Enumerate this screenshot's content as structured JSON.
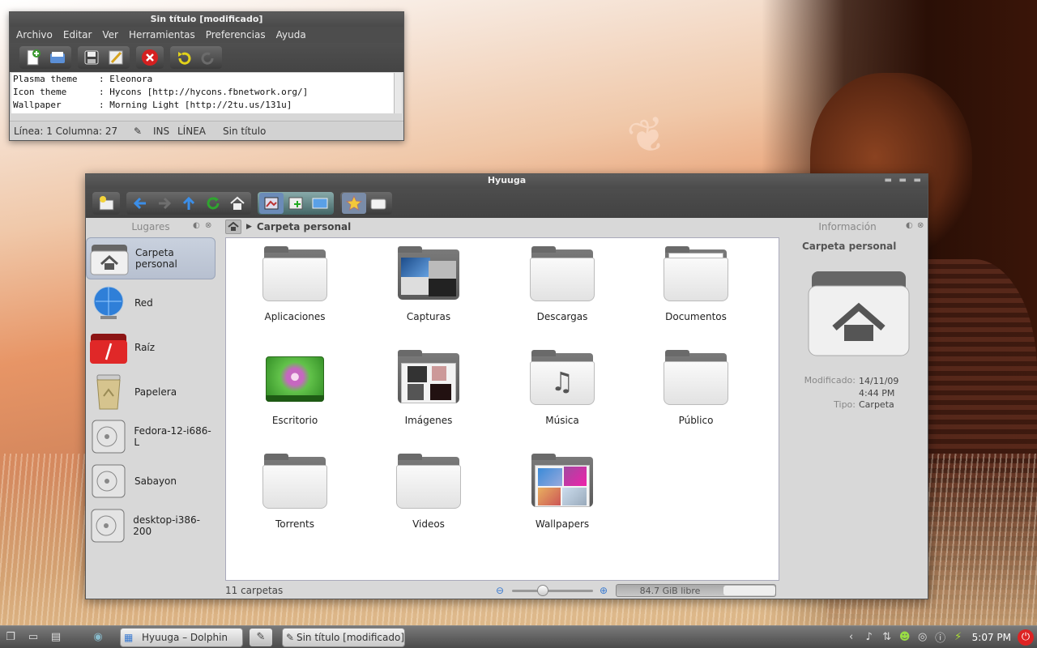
{
  "editor": {
    "title": "Sin título [modificado]",
    "menu": [
      "Archivo",
      "Editar",
      "Ver",
      "Herramientas",
      "Preferencias",
      "Ayuda"
    ],
    "lines": [
      "Plasma theme    : Eleonora",
      "Icon theme      : Hycons [http://hycons.fbnetwork.org/]",
      "Wallpaper       : Morning Light [http://2tu.us/131u]"
    ],
    "status": {
      "position": "Línea: 1 Columna: 27",
      "mode": "INS",
      "line_mode": "LÍNEA",
      "doc": "Sin título"
    }
  },
  "dolphin": {
    "title": "Hyuuga",
    "places_header": "Lugares",
    "places": [
      {
        "label": "Carpeta personal",
        "icon": "home-folder-icon",
        "selected": true
      },
      {
        "label": "Red",
        "icon": "network-globe-icon",
        "selected": false
      },
      {
        "label": "Raíz",
        "icon": "root-folder-icon",
        "selected": false
      },
      {
        "label": "Papelera",
        "icon": "trash-icon",
        "selected": false
      },
      {
        "label": "Fedora-12-i686-L",
        "icon": "drive-icon",
        "selected": false
      },
      {
        "label": "Sabayon",
        "icon": "drive-icon",
        "selected": false
      },
      {
        "label": "desktop-i386-200",
        "icon": "drive-icon",
        "selected": false
      }
    ],
    "breadcrumb": "Carpeta personal",
    "items": [
      {
        "label": "Aplicaciones",
        "type": "folder"
      },
      {
        "label": "Capturas",
        "type": "folder-screens"
      },
      {
        "label": "Descargas",
        "type": "folder"
      },
      {
        "label": "Documentos",
        "type": "folder-docs"
      },
      {
        "label": "Escritorio",
        "type": "desktop"
      },
      {
        "label": "Imágenes",
        "type": "folder-images"
      },
      {
        "label": "Música",
        "type": "folder-music"
      },
      {
        "label": "Público",
        "type": "folder"
      },
      {
        "label": "Torrents",
        "type": "folder"
      },
      {
        "label": "Videos",
        "type": "folder"
      },
      {
        "label": "Wallpapers",
        "type": "folder-wallpapers"
      }
    ],
    "info_header": "Información",
    "info": {
      "title": "Carpeta personal",
      "modified_label": "Modificado:",
      "modified_value": "14/11/09 4:44 PM",
      "type_label": "Tipo:",
      "type_value": "Carpeta"
    },
    "status": {
      "count": "11 carpetas",
      "free": "84.7 GiB libre",
      "zoom_fraction": 0.2
    }
  },
  "taskbar": {
    "tasks": [
      "Hyuuga – Dolphin",
      "Sin título [modificado]"
    ],
    "clock": "5:07 PM"
  },
  "colors": {
    "selection": "#c0c8d8",
    "window_chrome": "#4d4d4d",
    "panel_bg": "#d8d8d8"
  }
}
